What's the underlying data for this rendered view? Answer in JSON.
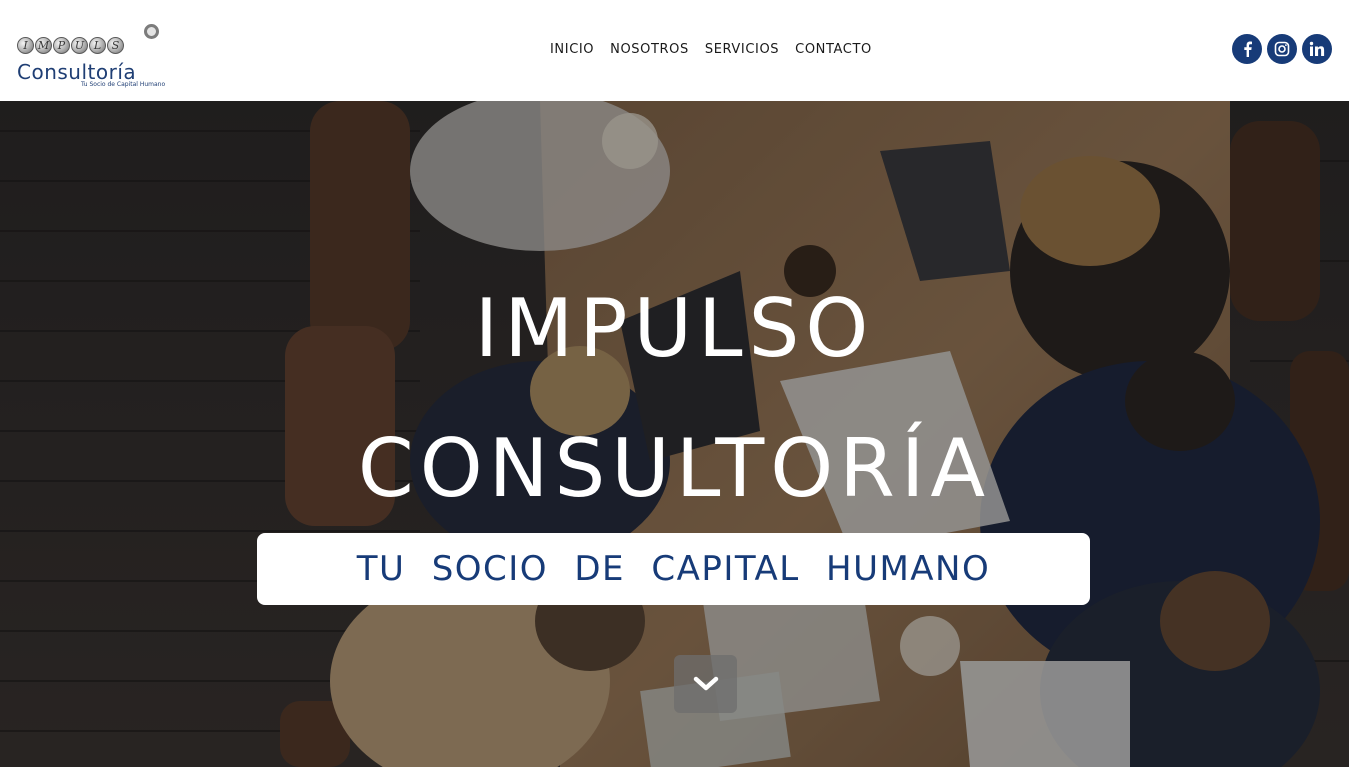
{
  "brand": {
    "logo_word_letters": [
      "I",
      "M",
      "P",
      "U",
      "L",
      "S",
      "O"
    ],
    "logo_consultoria": "Consultoría",
    "logo_tagline": "Tu Socio de Capital Humano",
    "logo_color": "#1f3e74"
  },
  "nav": {
    "items": [
      {
        "label": "INICIO"
      },
      {
        "label": "NOSOTROS"
      },
      {
        "label": "SERVICIOS"
      },
      {
        "label": "CONTACTO"
      }
    ]
  },
  "social": {
    "color": "#173b78",
    "icons": [
      "facebook-icon",
      "instagram-icon",
      "linkedin-icon"
    ]
  },
  "hero": {
    "title_line1": "IMPULSO",
    "title_line2": "CONSULTORÍA",
    "tagline": "TU SOCIO DE CAPITAL HUMANO",
    "scroll_icon": "chevron-down-icon",
    "background_description_icon": "meeting-photo"
  }
}
